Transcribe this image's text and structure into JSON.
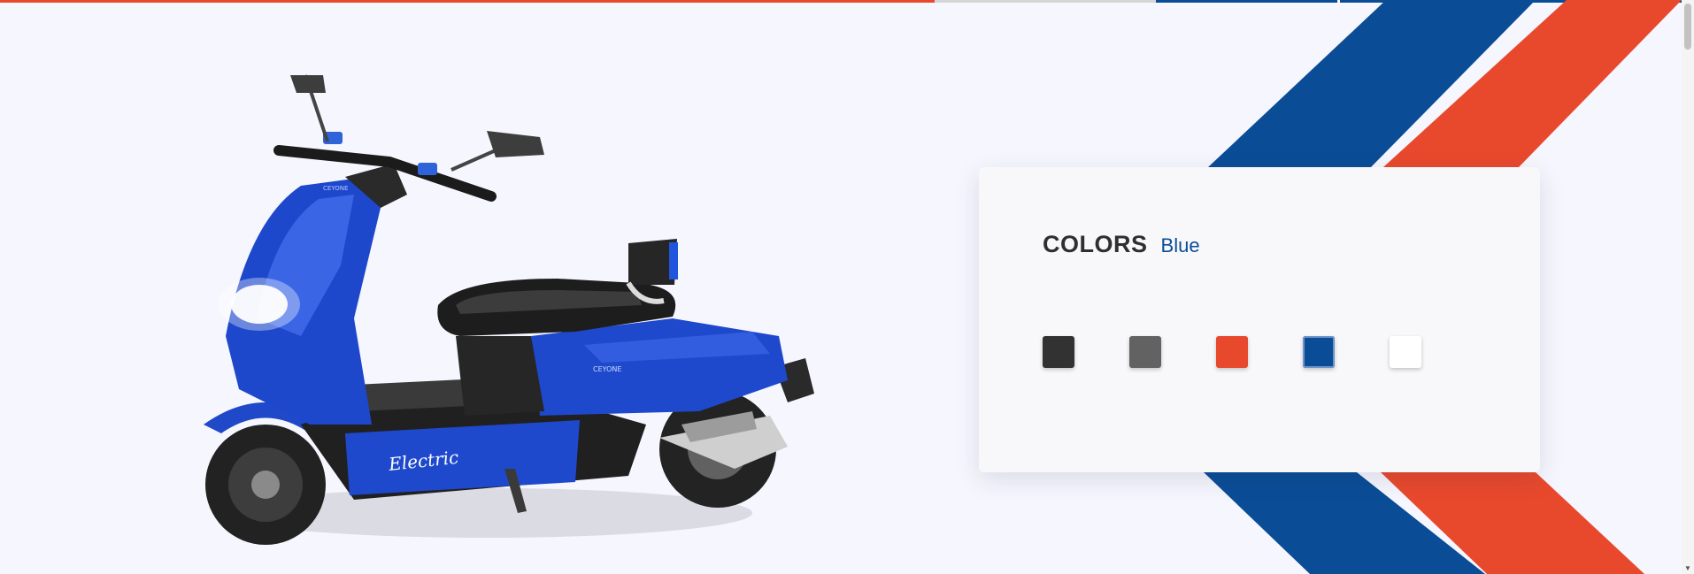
{
  "theme": {
    "stripe_blue": "#0a4d96",
    "stripe_red": "#e8492d",
    "background": "#f6f6fe"
  },
  "product_image": {
    "alt": "Electric scooter",
    "body_text": "Electric",
    "brand_text": "CEYONE"
  },
  "colors_panel": {
    "title": "COLORS",
    "selected_name": "Blue",
    "swatches": [
      {
        "name": "Black",
        "hex": "#323232"
      },
      {
        "name": "Grey",
        "hex": "#626262"
      },
      {
        "name": "Red",
        "hex": "#e8492d"
      },
      {
        "name": "Blue",
        "hex": "#0a4d96"
      },
      {
        "name": "White",
        "hex": "#ffffff"
      }
    ],
    "selected_index": 3
  },
  "top_strip_colors": [
    "#e8492d",
    "#d6d6d6",
    "#0a4d96",
    "#0a4d96"
  ]
}
